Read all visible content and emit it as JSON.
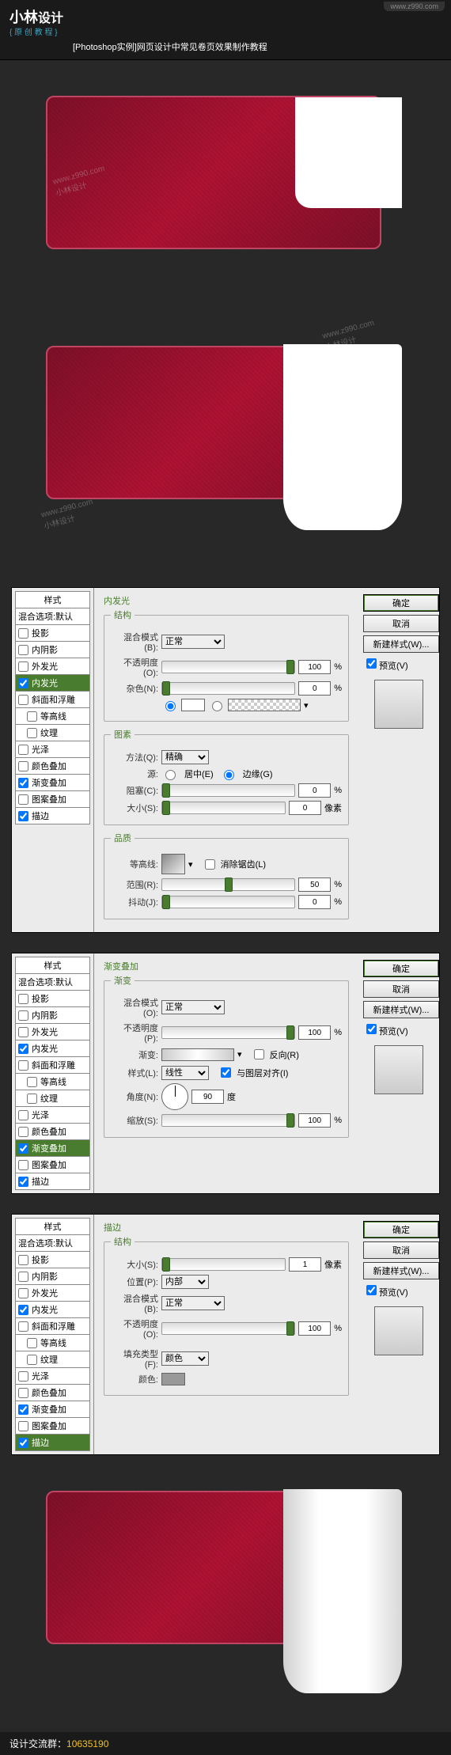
{
  "header": {
    "logo_en": "小林",
    "logo_cn": "设计",
    "subtitle": "{ 原 创 教 程 }",
    "title": "[Photoshop实例]网页设计中常见卷页效果制作教程",
    "url": "www.z990.com"
  },
  "watermark": {
    "url": "www.z990.com",
    "name": "小林设计"
  },
  "styles_list": {
    "header": "样式",
    "blend": "混合选项:默认",
    "drop_shadow": "投影",
    "inner_shadow": "内阴影",
    "outer_glow": "外发光",
    "inner_glow": "内发光",
    "bevel": "斜面和浮雕",
    "contour": "等高线",
    "texture": "纹理",
    "satin": "光泽",
    "color_overlay": "颜色叠加",
    "gradient_overlay": "渐变叠加",
    "pattern_overlay": "图案叠加",
    "stroke": "描边"
  },
  "buttons": {
    "ok": "确定",
    "cancel": "取消",
    "new_style": "新建样式(W)...",
    "preview": "预览(V)"
  },
  "panel1": {
    "title": "内发光",
    "g_structure": "结构",
    "blend_mode_l": "混合模式(B):",
    "blend_mode_v": "正常",
    "opacity_l": "不透明度(O):",
    "opacity_v": "100",
    "pct": "%",
    "noise_l": "杂色(N):",
    "noise_v": "0",
    "g_elements": "图素",
    "technique_l": "方法(Q):",
    "technique_v": "精确",
    "source_l": "源:",
    "center": "居中(E)",
    "edge": "边缘(G)",
    "choke_l": "阻塞(C):",
    "choke_v": "0",
    "size_l": "大小(S):",
    "size_v": "0",
    "px": "像素",
    "g_quality": "品质",
    "contour_l": "等高线:",
    "anti_alias": "消除锯齿(L)",
    "range_l": "范围(R):",
    "range_v": "50",
    "jitter_l": "抖动(J):",
    "jitter_v": "0"
  },
  "panel2": {
    "title": "渐变叠加",
    "g_gradient": "渐变",
    "blend_mode_l": "混合模式(O):",
    "blend_mode_v": "正常",
    "opacity_l": "不透明度(P):",
    "opacity_v": "100",
    "pct": "%",
    "gradient_l": "渐变:",
    "reverse": "反向(R)",
    "style_l": "样式(L):",
    "style_v": "线性",
    "align": "与图层对齐(I)",
    "angle_l": "角度(N):",
    "angle_v": "90",
    "deg": "度",
    "scale_l": "缩放(S):",
    "scale_v": "100"
  },
  "panel3": {
    "title": "描边",
    "g_structure": "结构",
    "size_l": "大小(S):",
    "size_v": "1",
    "px": "像素",
    "position_l": "位置(P):",
    "position_v": "内部",
    "blend_mode_l": "混合模式(B):",
    "blend_mode_v": "正常",
    "opacity_l": "不透明度(O):",
    "opacity_v": "100",
    "pct": "%",
    "fill_type_l": "填充类型(F):",
    "fill_type_v": "颜色",
    "color_l": "颜色:"
  },
  "footer": {
    "label": "设计交流群：",
    "number": "10635190"
  }
}
